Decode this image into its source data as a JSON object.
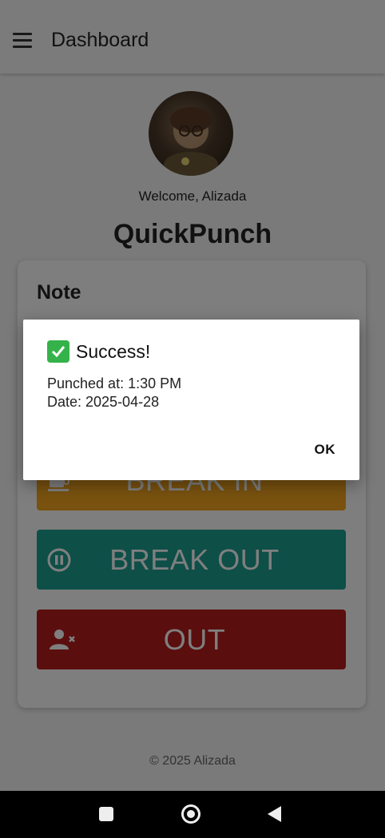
{
  "appbar": {
    "title": "Dashboard",
    "menu_icon": "hamburger-menu-icon"
  },
  "profile": {
    "welcome": "Welcome, Alizada",
    "app_name": "QuickPunch"
  },
  "card": {
    "note_title": "Note",
    "buttons": [
      {
        "label": "BREAK IN",
        "icon": "coffee-cup-icon",
        "color": "#f2a51f"
      },
      {
        "label": "BREAK OUT",
        "icon": "pause-circle-icon",
        "color": "#1c9f91"
      },
      {
        "label": "OUT",
        "icon": "person-remove-icon",
        "color": "#b71c1c"
      }
    ]
  },
  "footer": {
    "text": "© 2025 Alizada"
  },
  "dialog": {
    "icon": "check-mark-icon",
    "title": "Success!",
    "punched_at": "Punched at: 1:30 PM",
    "date": "Date: 2025-04-28",
    "ok_label": "OK"
  },
  "navbar": {
    "icons": [
      "recent-apps-icon",
      "home-icon",
      "back-icon"
    ]
  }
}
